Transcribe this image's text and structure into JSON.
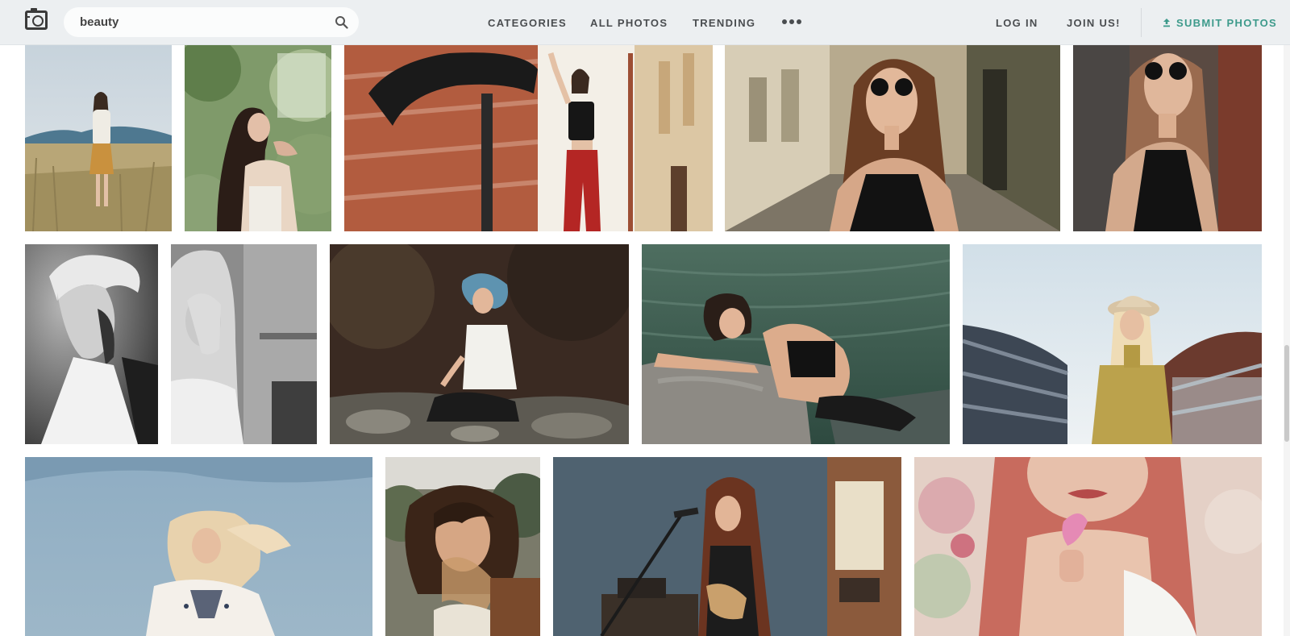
{
  "header": {
    "logo_icon": "camera-icon",
    "search": {
      "value": "beauty",
      "icon": "search-icon"
    },
    "nav": {
      "categories": "CATEGORIES",
      "all_photos": "ALL PHOTOS",
      "trending": "TRENDING",
      "more_icon": "more-dots-icon"
    },
    "auth": {
      "login": "LOG IN",
      "join": "JOIN US!"
    },
    "submit": {
      "label": "SUBMIT PHOTOS",
      "icon": "upload-icon"
    },
    "colors": {
      "bar": "#eceff1",
      "text": "#4a4d50",
      "accent": "#3d9a8b"
    }
  },
  "photos": [
    {
      "row": 1,
      "subject": "woman-in-wheat-field"
    },
    {
      "row": 1,
      "subject": "woman-among-leaves"
    },
    {
      "row": 1,
      "subject": "woman-by-brick-wall-with-bicycle"
    },
    {
      "row": 1,
      "subject": "woman-in-sunglasses-street"
    },
    {
      "row": 1,
      "subject": "woman-in-sunglasses-wall"
    },
    {
      "row": 2,
      "subject": "short-hair-monochrome-portrait"
    },
    {
      "row": 2,
      "subject": "long-hair-monochrome-portrait"
    },
    {
      "row": 2,
      "subject": "blue-hair-woman-sitting-on-rocks"
    },
    {
      "row": 2,
      "subject": "woman-lying-on-rock-by-water"
    },
    {
      "row": 2,
      "subject": "woman-in-hat-on-bridge"
    },
    {
      "row": 3,
      "subject": "woman-in-embroidered-blouse-sky"
    },
    {
      "row": 3,
      "subject": "woman-with-windblown-hair"
    },
    {
      "row": 3,
      "subject": "woman-singing-with-guitar"
    },
    {
      "row": 3,
      "subject": "red-hair-woman-holding-flower"
    }
  ]
}
